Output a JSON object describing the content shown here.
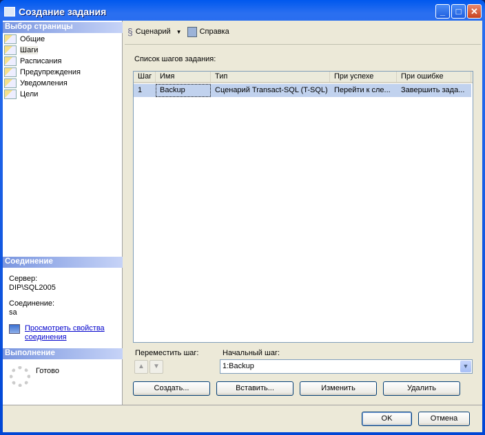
{
  "window": {
    "title": "Создание задания",
    "minimize": "_",
    "maximize": "□",
    "close": "✕"
  },
  "sidebar": {
    "select_page_header": "Выбор страницы",
    "items": [
      {
        "label": "Общие"
      },
      {
        "label": "Шаги",
        "selected": true
      },
      {
        "label": "Расписания"
      },
      {
        "label": "Предупреждения"
      },
      {
        "label": "Уведомления"
      },
      {
        "label": "Цели"
      }
    ],
    "connection_header": "Соединение",
    "server_label": "Сервер:",
    "server_value": "DIP\\SQL2005",
    "connection_label": "Соединение:",
    "connection_value": "sa",
    "view_props_link_1": "Просмотреть свойства",
    "view_props_link_2": "соединения",
    "progress_header": "Выполнение",
    "progress_status": "Готово"
  },
  "toolbar": {
    "script": "Сценарий",
    "help": "Справка"
  },
  "main": {
    "steps_list_label": "Список шагов задания:",
    "columns": [
      "Шаг",
      "Имя",
      "Тип",
      "При успехе",
      "При ошибке"
    ],
    "rows": [
      [
        "1",
        "Backup",
        "Сценарий Transact-SQL (T-SQL)",
        "Перейти к сле...",
        "Завершить зада..."
      ]
    ],
    "move_step_label": "Переместить шаг:",
    "start_step_label": "Начальный шаг:",
    "start_step_value": "1:Backup",
    "buttons": {
      "new": "Создать...",
      "insert": "Вставить...",
      "edit": "Изменить",
      "delete": "Удалить"
    }
  },
  "footer": {
    "ok": "OK",
    "cancel": "Отмена"
  },
  "colors": {
    "title_bar": "#0058ee",
    "selection": "#c1d2ee",
    "section_header": "#7a96df"
  }
}
